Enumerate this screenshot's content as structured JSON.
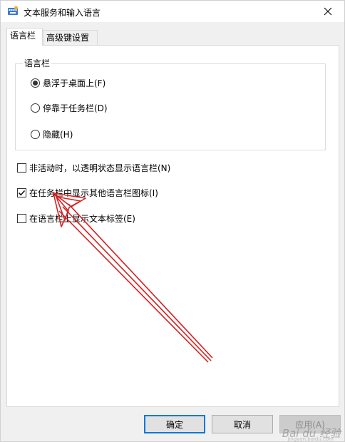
{
  "window": {
    "title": "文本服务和输入语言",
    "close_icon": "close-icon"
  },
  "tabs": [
    {
      "label": "语言栏",
      "active": true
    },
    {
      "label": "高级键设置",
      "active": false
    }
  ],
  "language_bar_group": {
    "title": "语言栏",
    "options": [
      {
        "label": "悬浮于桌面上(F)",
        "selected": true
      },
      {
        "label": "停靠于任务栏(D)",
        "selected": false
      },
      {
        "label": "隐藏(H)",
        "selected": false
      }
    ]
  },
  "checkboxes": [
    {
      "label": "非活动时，以透明状态显示语言栏(N)",
      "checked": false
    },
    {
      "label": "在任务栏中显示其他语言栏图标(I)",
      "checked": true
    },
    {
      "label": "在语言栏上显示文本标签(E)",
      "checked": false
    }
  ],
  "buttons": {
    "ok": "确定",
    "cancel": "取消",
    "apply": "应用(A)"
  },
  "watermark": {
    "text": "Bai du 经验",
    "url": "jingyan.baidu.com"
  },
  "annotation_color": "#d42020"
}
